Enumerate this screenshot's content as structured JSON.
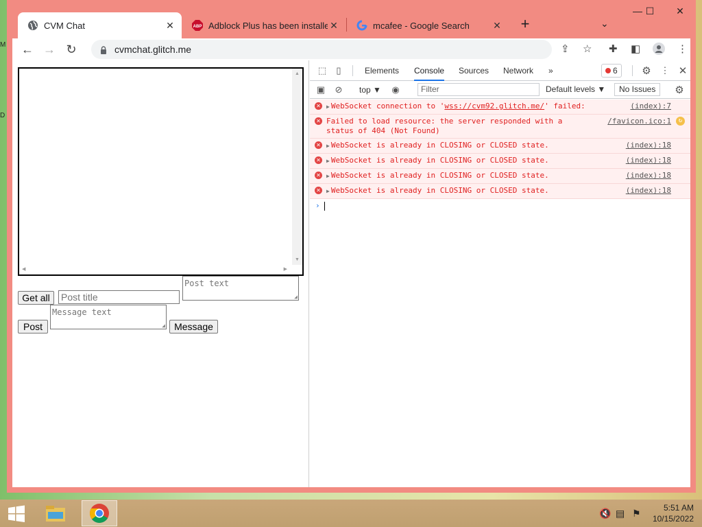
{
  "desktop": {
    "edge_letters": [
      "M",
      "D"
    ]
  },
  "browser": {
    "tabs": [
      {
        "title": "CVM Chat",
        "icon": "globe-icon",
        "active": true
      },
      {
        "title": "Adblock Plus has been installed!",
        "icon": "abp-icon",
        "icon_text": "ABP",
        "active": false
      },
      {
        "title": "mcafee - Google Search",
        "icon": "google-icon",
        "active": false
      }
    ],
    "tab_close": "✕",
    "new_tab": "+",
    "window_controls": {
      "minimize": "—",
      "maximize": "☐",
      "close": "✕"
    },
    "address": {
      "url": "cvmchat.glitch.me"
    }
  },
  "page": {
    "get_all_label": "Get all",
    "post_title_placeholder": "Post title",
    "post_text_placeholder": "Post text",
    "post_label": "Post",
    "message_text_placeholder": "Message text",
    "message_label": "Message"
  },
  "devtools": {
    "tabs": [
      "Elements",
      "Console",
      "Sources",
      "Network"
    ],
    "active_tab": "Console",
    "more_tabs": "»",
    "error_count": "6",
    "context": "top ▼",
    "filter_placeholder": "Filter",
    "levels_label": "Default levels ▼",
    "issues_label": "No Issues",
    "messages": [
      {
        "pre": "WebSocket connection to '",
        "url": "wss://cvm92.glitch.me/",
        "post": "' failed:",
        "source": "(index):7",
        "expandable": true
      },
      {
        "pre": "Failed to load resource: the server responded with a status of 404 (Not Found)",
        "url": "",
        "post": "",
        "source": "/favicon.ico:1",
        "expandable": false
      },
      {
        "pre": "WebSocket is already in CLOSING or CLOSED state.",
        "url": "",
        "post": "",
        "source": "(index):18",
        "expandable": true
      },
      {
        "pre": "WebSocket is already in CLOSING or CLOSED state.",
        "url": "",
        "post": "",
        "source": "(index):18",
        "expandable": true
      },
      {
        "pre": "WebSocket is already in CLOSING or CLOSED state.",
        "url": "",
        "post": "",
        "source": "(index):18",
        "expandable": true
      },
      {
        "pre": "WebSocket is already in CLOSING or CLOSED state.",
        "url": "",
        "post": "",
        "source": "(index):18",
        "expandable": true
      }
    ],
    "prompt_symbol": "›"
  },
  "taskbar": {
    "clock": {
      "time": "5:51 AM",
      "date": "10/15/2022"
    }
  },
  "colors": {
    "window_frame": "#f28b82",
    "error_text": "#e02020",
    "error_bg": "#fff0f0",
    "accent": "#1a73e8"
  }
}
